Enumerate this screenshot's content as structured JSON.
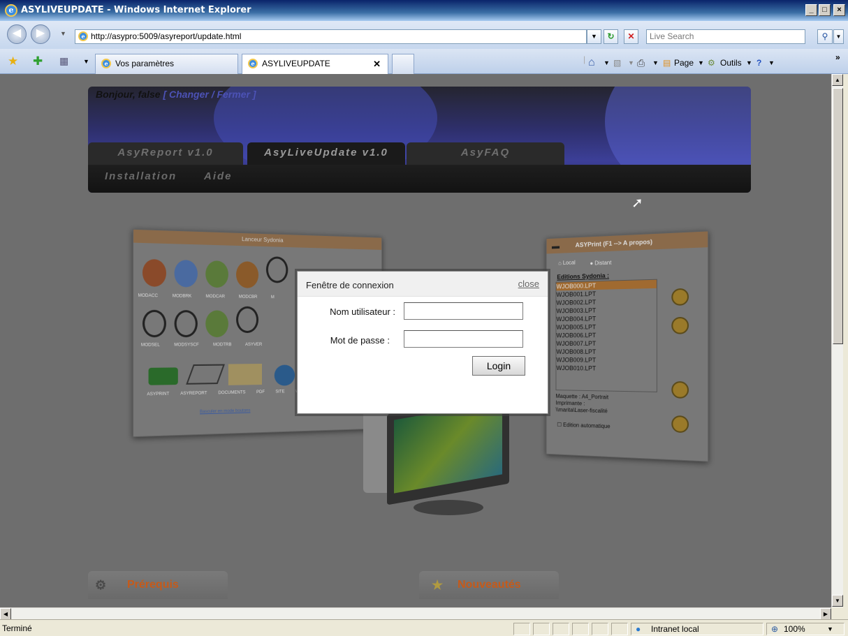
{
  "window": {
    "title": "ASYLIVEUPDATE - Windows Internet Explorer",
    "min": "_",
    "max": "□",
    "close": "×"
  },
  "address": {
    "url": "http://asypro:5009/asyreport/update.html",
    "search_placeholder": "Live Search"
  },
  "tabs": [
    {
      "label": "Vos paramètres"
    },
    {
      "label": "ASYLIVEUPDATE",
      "close": "✕"
    }
  ],
  "toolbar": {
    "page": "Page",
    "tools": "Outils",
    "more": "»"
  },
  "page": {
    "greeting_prefix": "Bonjour, false",
    "greeting_links": "[ Changer / Fermer ]",
    "tabs": [
      "AsyReport v1.0",
      "AsyLiveUpdate v1.0",
      "AsyFAQ"
    ],
    "submenu": [
      "Installation",
      "Aide"
    ],
    "sections": [
      "Prérequis",
      "Nouveautés"
    ]
  },
  "launcher": {
    "title": "Lanceur Sydonia",
    "row1": [
      "MODACC",
      "MODBRK",
      "MODCAR",
      "MODCBR",
      "M"
    ],
    "row2": [
      "MODSEL",
      "MODSYSCF",
      "MODTRB",
      "ASYVER"
    ],
    "row3": [
      "ASYPRINT",
      "ASYREPORT",
      "DOCUMENTS PDF",
      "SITE W"
    ],
    "link": "Basculer en mode boutons"
  },
  "asyprint": {
    "title": "ASYPrint (F1 --> A propos)",
    "tab_local": "Local",
    "tab_distant": "Distant",
    "heading": "Editions Sydonia :",
    "files": [
      "WJOB000.LPT",
      "WJOB001.LPT",
      "WJOB002.LPT",
      "WJOB003.LPT",
      "WJOB004.LPT",
      "WJOB005.LPT",
      "WJOB006.LPT",
      "WJOB007.LPT",
      "WJOB008.LPT",
      "WJOB009.LPT",
      "WJOB010.LPT"
    ],
    "maquette": "Maquette : A4_Portrait",
    "imprimante": "Imprimante :",
    "printer": "\\\\marita\\Laser-fiscalité",
    "auto": "Edition automatique"
  },
  "modal": {
    "title": "Fenêtre de connexion",
    "close": "close",
    "user_label": "Nom utilisateur :",
    "user_value": "",
    "pass_label": "Mot de passe :",
    "pass_value": "",
    "login": "Login"
  },
  "status": {
    "text": "Terminé",
    "zone": "Intranet local",
    "zoom": "100%"
  }
}
